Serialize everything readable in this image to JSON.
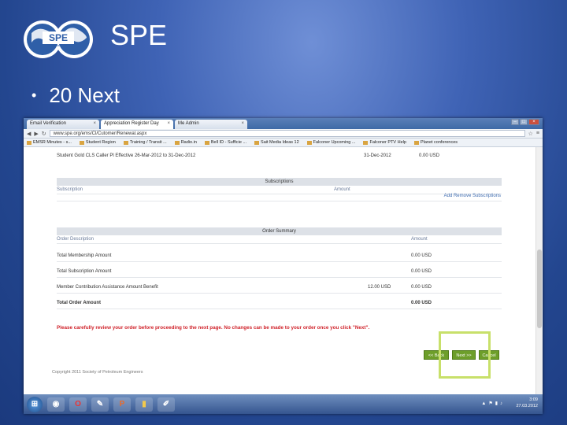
{
  "slide": {
    "title": "SPE",
    "logo_text": "SPE",
    "logo_subtext": "International",
    "bullet": "20 Next"
  },
  "browser": {
    "tabs": [
      {
        "label": "Email Verification",
        "active": false
      },
      {
        "label": "Appreciation Register Day",
        "active": true
      },
      {
        "label": "Me Admin",
        "active": false
      }
    ],
    "url": "www.spe.org/ems/Cl/Cutomer/Renewal.aspx",
    "bookmarks": [
      "EMSR Minutes - s...",
      "Student Region",
      "Training / Transit ...",
      "Radio.in",
      "Bell ID - Sufficie ...",
      "Sait Media Ideas 12",
      "Falconer Upcoming ...",
      "Falconer PTV Help",
      "Planet conferences"
    ]
  },
  "order_page": {
    "top_row": {
      "description": "Student Gold CLS Caller Pl Effective 26-Mar-2012 to 31-Dec-2012",
      "date": "31-Dec-2012",
      "amount": "0.00 USD"
    },
    "subscriptions_header": "Subscriptions",
    "subscription_col": "Subscription",
    "amount_col": "Amount",
    "add_remove_link": "Add Remove Subscriptions",
    "order_summary_header": "Order Summary",
    "order_description_col": "Order Description",
    "order_amount_col": "Amount",
    "lines": [
      {
        "label": "Total Membership Amount",
        "mid": "",
        "amount": "0.00 USD",
        "bold": false
      },
      {
        "label": "Total Subscription Amount",
        "mid": "",
        "amount": "0.00 USD",
        "bold": false
      },
      {
        "label": "Member Contribution Assistance Amount Benefit",
        "mid": "12.00 USD",
        "amount": "0.00 USD",
        "bold": false
      },
      {
        "label": "Total Order Amount",
        "mid": "",
        "amount": "0.00 USD",
        "bold": true
      }
    ],
    "warning": "Please carefully review your order before proceeding to the next page. No changes can be made to your order once you click \"Next\".",
    "back_button": "<< Back",
    "next_button": "Next >>",
    "cancel_button": "Cancel",
    "copyright": "Copyright 2011 Society of Petroleum Engineers"
  },
  "taskbar": {
    "time": "3:09",
    "date": "27.03.2012",
    "lang": "EN"
  },
  "colors": {
    "slide_bg": "#2f52a0",
    "button_green": "#6d9e2a",
    "warning_red": "#d0232b",
    "highlight": "#c8e06a"
  }
}
